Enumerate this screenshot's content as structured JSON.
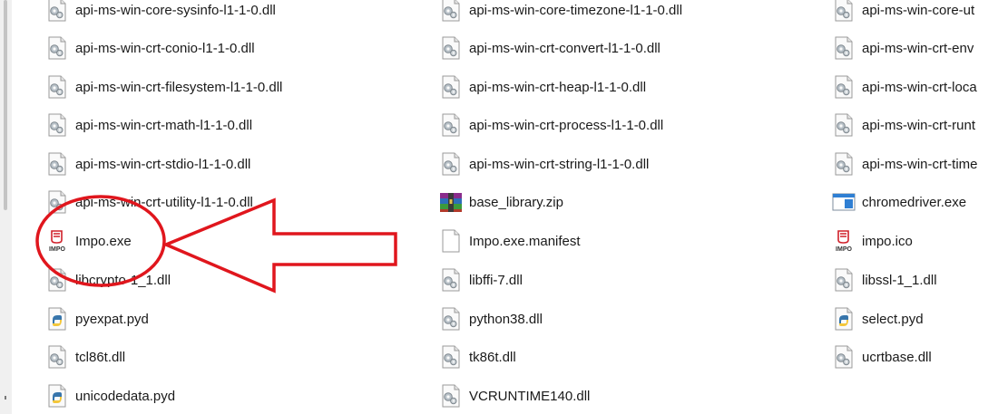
{
  "files": [
    {
      "name": "api-ms-win-core-sysinfo-l1-1-0.dll",
      "icon": "dll-icon"
    },
    {
      "name": "api-ms-win-core-timezone-l1-1-0.dll",
      "icon": "dll-icon"
    },
    {
      "name": "api-ms-win-core-ut",
      "icon": "dll-icon"
    },
    {
      "name": "api-ms-win-crt-conio-l1-1-0.dll",
      "icon": "dll-icon"
    },
    {
      "name": "api-ms-win-crt-convert-l1-1-0.dll",
      "icon": "dll-icon"
    },
    {
      "name": "api-ms-win-crt-env",
      "icon": "dll-icon"
    },
    {
      "name": "api-ms-win-crt-filesystem-l1-1-0.dll",
      "icon": "dll-icon"
    },
    {
      "name": "api-ms-win-crt-heap-l1-1-0.dll",
      "icon": "dll-icon"
    },
    {
      "name": "api-ms-win-crt-loca",
      "icon": "dll-icon"
    },
    {
      "name": "api-ms-win-crt-math-l1-1-0.dll",
      "icon": "dll-icon"
    },
    {
      "name": "api-ms-win-crt-process-l1-1-0.dll",
      "icon": "dll-icon"
    },
    {
      "name": "api-ms-win-crt-runt",
      "icon": "dll-icon"
    },
    {
      "name": "api-ms-win-crt-stdio-l1-1-0.dll",
      "icon": "dll-icon"
    },
    {
      "name": "api-ms-win-crt-string-l1-1-0.dll",
      "icon": "dll-icon"
    },
    {
      "name": "api-ms-win-crt-time",
      "icon": "dll-icon"
    },
    {
      "name": "api-ms-win-crt-utility-l1-1-0.dll",
      "icon": "dll-icon"
    },
    {
      "name": "base_library.zip",
      "icon": "zip-archive-icon"
    },
    {
      "name": "chromedriver.exe",
      "icon": "exe-window-icon"
    },
    {
      "name": "Impo.exe",
      "icon": "impo-app-icon"
    },
    {
      "name": "Impo.exe.manifest",
      "icon": "blank-file-icon"
    },
    {
      "name": "impo.ico",
      "icon": "impo-app-icon"
    },
    {
      "name": "libcrypto-1_1.dll",
      "icon": "dll-icon"
    },
    {
      "name": "libffi-7.dll",
      "icon": "dll-icon"
    },
    {
      "name": "libssl-1_1.dll",
      "icon": "dll-icon"
    },
    {
      "name": "pyexpat.pyd",
      "icon": "python-file-icon"
    },
    {
      "name": "python38.dll",
      "icon": "dll-icon"
    },
    {
      "name": "select.pyd",
      "icon": "python-file-icon"
    },
    {
      "name": "tcl86t.dll",
      "icon": "dll-icon"
    },
    {
      "name": "tk86t.dll",
      "icon": "dll-icon"
    },
    {
      "name": "ucrtbase.dll",
      "icon": "dll-icon"
    },
    {
      "name": "unicodedata.pyd",
      "icon": "python-file-icon"
    },
    {
      "name": "VCRUNTIME140.dll",
      "icon": "dll-icon"
    }
  ],
  "impo_icon_caption": "IMPO",
  "colors": {
    "annotation_red": "#e0161d",
    "text": "#1a1a1a",
    "selection_scrollbar": "#c4c4c4"
  }
}
